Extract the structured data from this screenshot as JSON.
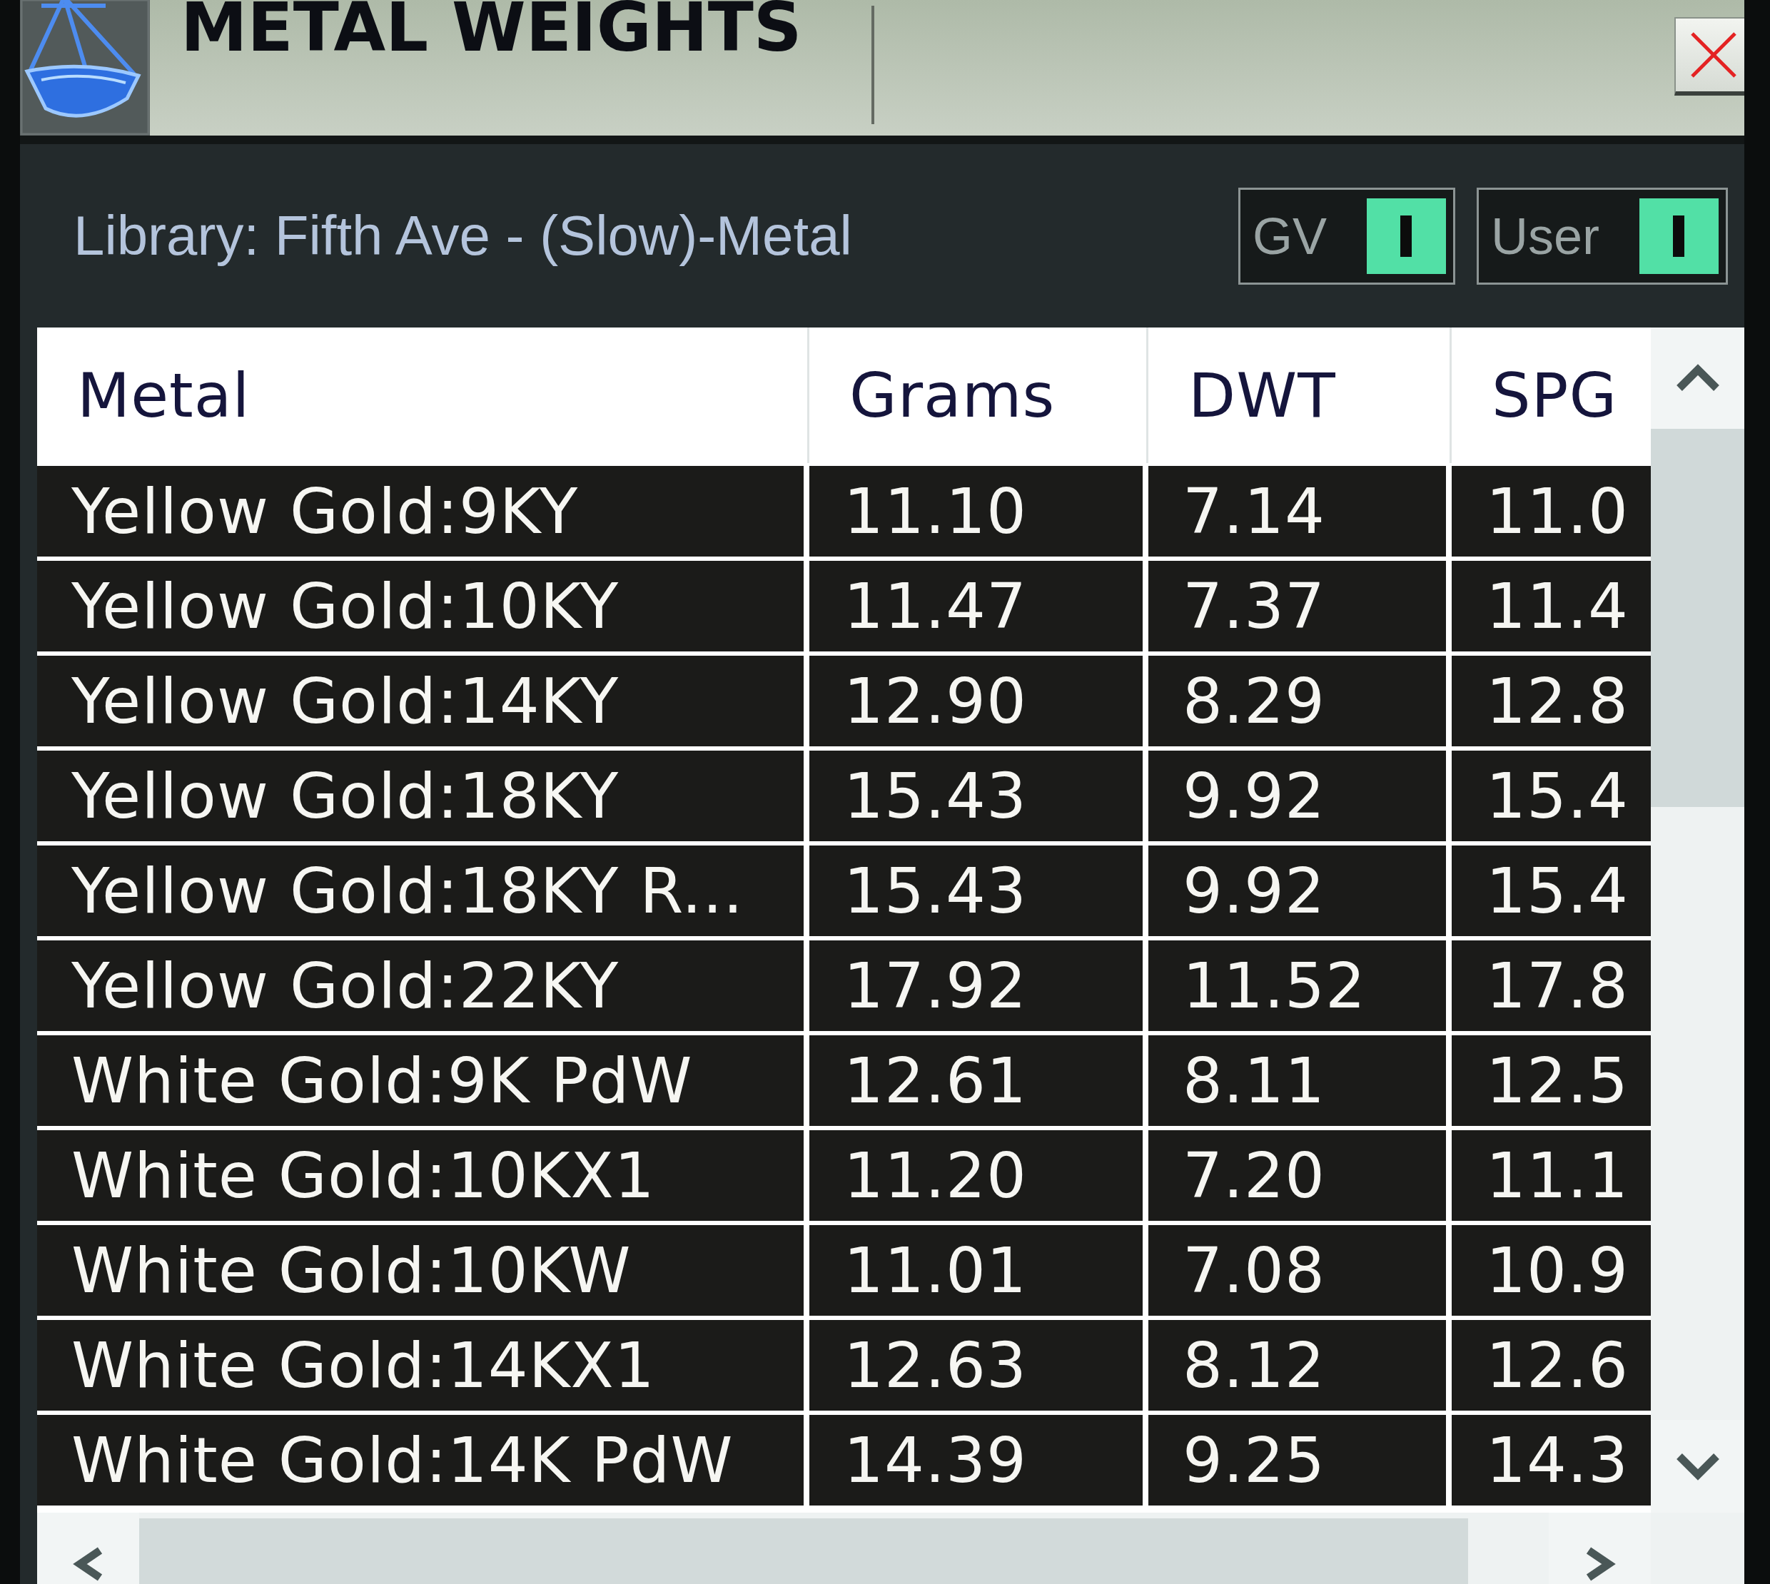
{
  "window": {
    "title": "METAL WEIGHTS"
  },
  "library": {
    "label": "Library: Fifth Ave - (Slow)-Metal"
  },
  "toggles": [
    {
      "label": "GV",
      "on": true
    },
    {
      "label": "User",
      "on": true
    }
  ],
  "table": {
    "columns": [
      "Metal",
      "Grams",
      "DWT",
      "SPG"
    ],
    "rows": [
      [
        "Yellow Gold:9KY",
        "11.10",
        "7.14",
        "11.0"
      ],
      [
        "Yellow Gold:10KY",
        "11.47",
        "7.37",
        "11.4"
      ],
      [
        "Yellow Gold:14KY",
        "12.90",
        "8.29",
        "12.8"
      ],
      [
        "Yellow Gold:18KY",
        "15.43",
        "9.92",
        "15.4"
      ],
      [
        "Yellow Gold:18KY R...",
        "15.43",
        "9.92",
        "15.4"
      ],
      [
        "Yellow Gold:22KY",
        "17.92",
        "11.52",
        "17.8"
      ],
      [
        "White Gold:9K PdW",
        "12.61",
        "8.11",
        "12.5"
      ],
      [
        "White Gold:10KX1",
        "11.20",
        "7.20",
        "11.1"
      ],
      [
        "White Gold:10KW",
        "11.01",
        "7.08",
        "10.9"
      ],
      [
        "White Gold:14KX1",
        "12.63",
        "8.12",
        "12.6"
      ],
      [
        "White Gold:14K PdW",
        "14.39",
        "9.25",
        "14.3"
      ]
    ]
  }
}
